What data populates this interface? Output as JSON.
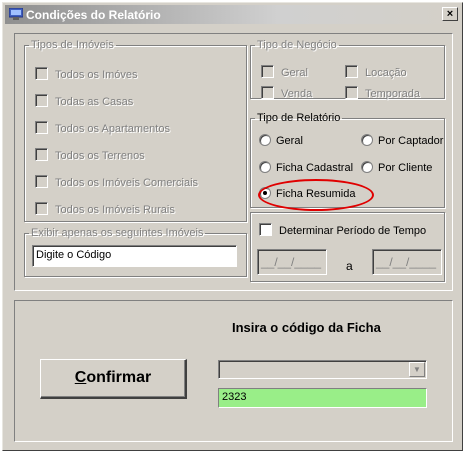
{
  "window": {
    "title": "Condições do Relatório",
    "close_label": "×"
  },
  "tipos_imoveis": {
    "legend": "Tipos de Imóveis",
    "options": [
      {
        "label": "Todos os Imóves",
        "checked": false,
        "enabled": false
      },
      {
        "label": "Todas as Casas",
        "checked": false,
        "enabled": false
      },
      {
        "label": "Todos os Apartamentos",
        "checked": false,
        "enabled": false
      },
      {
        "label": "Todos os Terrenos",
        "checked": false,
        "enabled": false
      },
      {
        "label": "Todos os Imóveis Comerciais",
        "checked": false,
        "enabled": false
      },
      {
        "label": "Todos os Imóveis Rurais",
        "checked": false,
        "enabled": false
      }
    ]
  },
  "exibir": {
    "legend": "Exibir apenas os seguintes Imóveis",
    "value": "Digite o Código"
  },
  "tipo_negocio": {
    "legend": "Tipo de Negócio",
    "options": [
      {
        "label": "Geral",
        "checked": false,
        "enabled": false
      },
      {
        "label": "Locação",
        "checked": false,
        "enabled": false
      },
      {
        "label": "Venda",
        "checked": false,
        "enabled": false
      },
      {
        "label": "Temporada",
        "checked": false,
        "enabled": false
      }
    ]
  },
  "tipo_relatorio": {
    "legend": "Tipo de Relatório",
    "options": [
      {
        "label": "Geral",
        "selected": false
      },
      {
        "label": "Por Captador",
        "selected": false
      },
      {
        "label": "Ficha Cadastral",
        "selected": false
      },
      {
        "label": "Por Cliente",
        "selected": false
      },
      {
        "label": "Ficha Resumida",
        "selected": true
      }
    ]
  },
  "periodo": {
    "label": "Determinar Período de Tempo",
    "checked": false,
    "start_value": "__/__/____",
    "end_value": "__/__/____",
    "separator": "a"
  },
  "bottom": {
    "heading": "Insira o código da Ficha",
    "confirm_underlined": "C",
    "confirm_rest": "onfirmar",
    "combo_value": "",
    "code_value": "2323"
  },
  "colors": {
    "highlight": "#e00000",
    "code_field_bg": "#99ee88",
    "dialog_bg": "#d4d0c8"
  }
}
